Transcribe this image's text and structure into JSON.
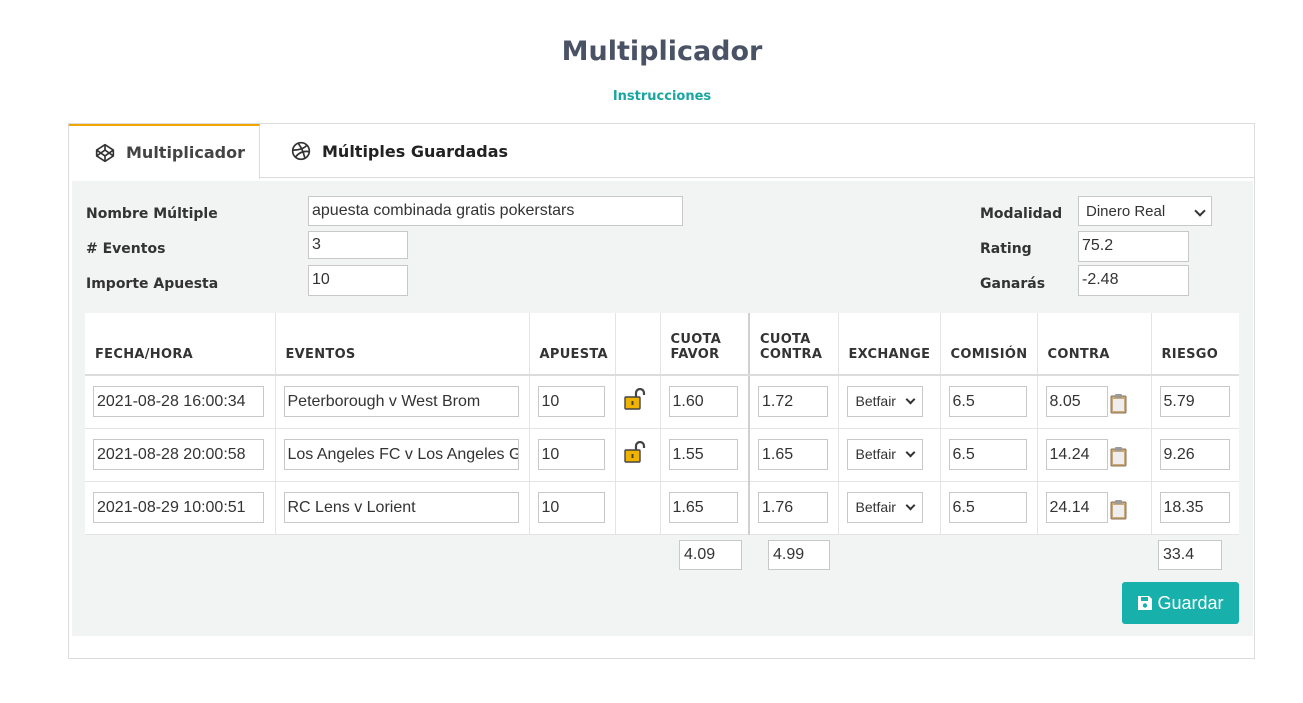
{
  "header": {
    "title": "Multiplicador",
    "instructions_link": "Instrucciones"
  },
  "tabs": [
    {
      "label": "Multiplicador",
      "icon": "codepen-icon",
      "active": true
    },
    {
      "label": "Múltiples Guardadas",
      "icon": "dribbble-icon",
      "active": false
    }
  ],
  "form": {
    "name_label": "Nombre Múltiple",
    "name_value": "apuesta combinada gratis pokerstars",
    "events_label": "# Eventos",
    "events_value": "3",
    "amount_label": "Importe Apuesta",
    "amount_value": "10",
    "mode_label": "Modalidad",
    "mode_value": "Dinero Real",
    "rating_label": "Rating",
    "rating_value": "75.2",
    "win_label": "Ganarás",
    "win_value": "-2.48"
  },
  "table": {
    "headers": {
      "date": "FECHA/HORA",
      "events": "EVENTOS",
      "stake": "APUESTA",
      "odds_for_1": "CUOTA",
      "odds_for_2": "FAVOR",
      "odds_against_1": "CUOTA",
      "odds_against_2": "CONTRA",
      "exchange": "EXCHANGE",
      "commission": "COMISIÓN",
      "lay": "CONTRA",
      "risk": "RIESGO"
    },
    "rows": [
      {
        "date": "2021-08-28 16:00:34",
        "event": "Peterborough v West Brom",
        "stake": "10",
        "odds_for": "1.60",
        "odds_against": "1.72",
        "exchange": "Betfair",
        "commission": "6.5",
        "lay": "8.05",
        "risk": "5.79"
      },
      {
        "date": "2021-08-28 20:00:58",
        "event": "Los Angeles FC v Los Angeles Galaxy",
        "stake": "10",
        "odds_for": "1.55",
        "odds_against": "1.65",
        "exchange": "Betfair",
        "commission": "6.5",
        "lay": "14.24",
        "risk": "9.26"
      },
      {
        "date": "2021-08-29 10:00:51",
        "event": "RC Lens v Lorient",
        "stake": "10",
        "odds_for": "1.65",
        "odds_against": "1.76",
        "exchange": "Betfair",
        "commission": "6.5",
        "lay": "24.14",
        "risk": "18.35"
      }
    ],
    "totals": {
      "odds_for": "4.09",
      "odds_against": "4.99",
      "risk": "33.4"
    }
  },
  "save_label": "Guardar",
  "colors": {
    "accent": "#17b0aa",
    "tab_active": "#f0a500",
    "title": "#4a5365",
    "lock": "#f0b400"
  }
}
